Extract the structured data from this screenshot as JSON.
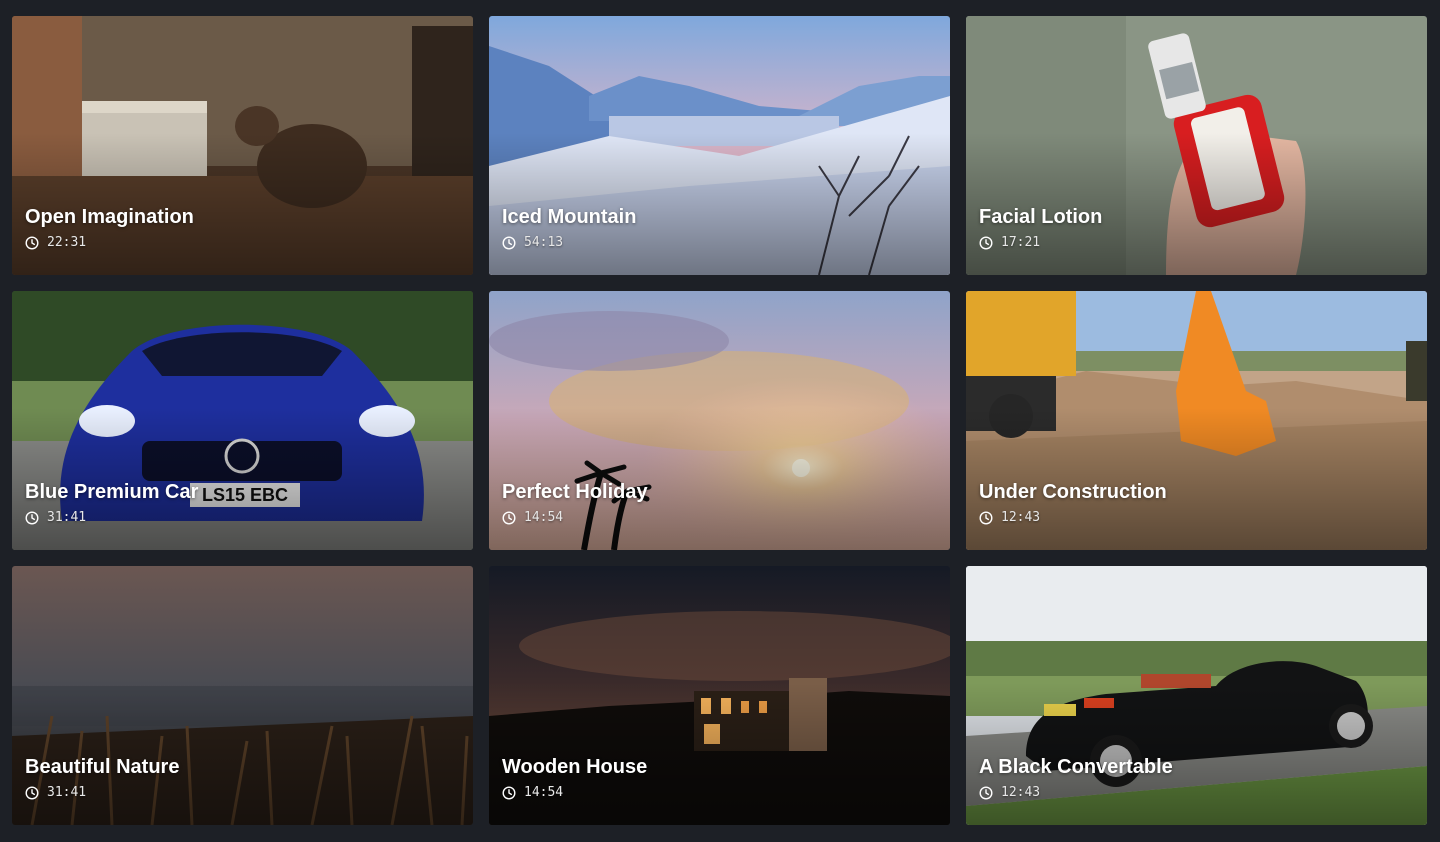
{
  "videos": [
    {
      "title": "Open Imagination",
      "duration": "22:31",
      "icon": "clock-icon"
    },
    {
      "title": "Iced Mountain",
      "duration": "54:13",
      "icon": "clock-icon"
    },
    {
      "title": "Facial Lotion",
      "duration": "17:21",
      "icon": "clock-icon"
    },
    {
      "title": "Blue Premium Car",
      "duration": "31:41",
      "icon": "clock-icon"
    },
    {
      "title": "Perfect Holiday",
      "duration": "14:54",
      "icon": "clock-icon"
    },
    {
      "title": "Under Construction",
      "duration": "12:43",
      "icon": "clock-icon"
    },
    {
      "title": "Beautiful Nature",
      "duration": "31:41",
      "icon": "clock-icon"
    },
    {
      "title": "Wooden House",
      "duration": "14:54",
      "icon": "clock-icon"
    },
    {
      "title": "A Black Convertable",
      "duration": "12:43",
      "icon": "clock-icon"
    }
  ],
  "colors": {
    "page_background": "#1d2026",
    "title_text": "#ffffff",
    "duration_text": "#e8e8e8"
  }
}
